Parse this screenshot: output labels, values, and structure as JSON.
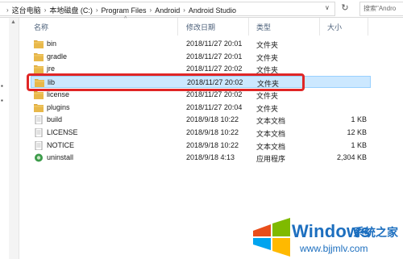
{
  "address": {
    "crumbs": [
      "这台电脑",
      "本地磁盘 (C:)",
      "Program Files",
      "Android",
      "Android Studio"
    ],
    "search_placeholder": "搜索\"Andro"
  },
  "columns": {
    "name": "名称",
    "date": "修改日期",
    "type": "类型",
    "size": "大小"
  },
  "files": [
    {
      "name": "bin",
      "date": "2018/11/27 20:01",
      "type": "文件夹",
      "size": "",
      "icon": "folder-icon"
    },
    {
      "name": "gradle",
      "date": "2018/11/27 20:01",
      "type": "文件夹",
      "size": "",
      "icon": "folder-icon"
    },
    {
      "name": "jre",
      "date": "2018/11/27 20:02",
      "type": "文件夹",
      "size": "",
      "icon": "folder-icon"
    },
    {
      "name": "lib",
      "date": "2018/11/27 20:02",
      "type": "文件夹",
      "size": "",
      "icon": "folder-icon",
      "selected": true
    },
    {
      "name": "license",
      "date": "2018/11/27 20:02",
      "type": "文件夹",
      "size": "",
      "icon": "folder-icon"
    },
    {
      "name": "plugins",
      "date": "2018/11/27 20:04",
      "type": "文件夹",
      "size": "",
      "icon": "folder-icon"
    },
    {
      "name": "build",
      "date": "2018/9/18 10:22",
      "type": "文本文档",
      "size": "1 KB",
      "icon": "text-file-icon"
    },
    {
      "name": "LICENSE",
      "date": "2018/9/18 10:22",
      "type": "文本文档",
      "size": "12 KB",
      "icon": "text-file-icon"
    },
    {
      "name": "NOTICE",
      "date": "2018/9/18 10:22",
      "type": "文本文档",
      "size": "1 KB",
      "icon": "text-file-icon"
    },
    {
      "name": "uninstall",
      "date": "2018/9/18 4:13",
      "type": "应用程序",
      "size": "2,304 KB",
      "icon": "uninstall-app-icon"
    }
  ],
  "watermark": {
    "brand": "Windows",
    "cn": "系统之家",
    "url": "www.bjjmlv.com"
  },
  "colors": {
    "selection_bg": "#cce8ff",
    "highlight": "#e02626",
    "folder": "#e8b84a",
    "brand_blue": "#1d6fbf"
  }
}
